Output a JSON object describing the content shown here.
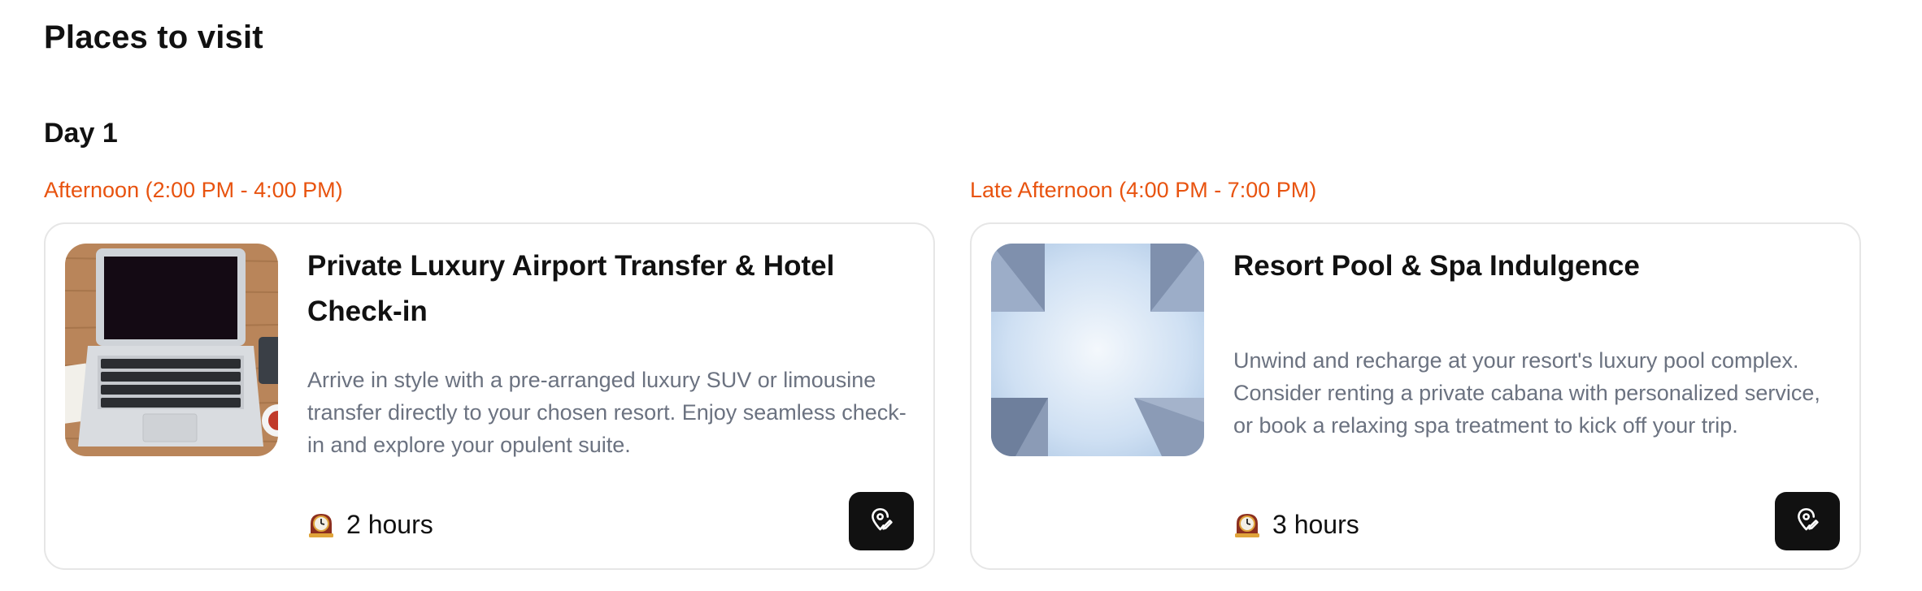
{
  "page": {
    "title": "Places to visit"
  },
  "day": {
    "heading": "Day 1"
  },
  "slots": [
    {
      "time": "Afternoon (2:00 PM - 4:00 PM)",
      "card": {
        "image_icon": "laptop-photo",
        "title": "Private Luxury Airport Transfer & Hotel Check-in",
        "description": "Arrive in style with a pre-arranged luxury SUV or limousine transfer directly to your chosen resort. Enjoy seamless check-in and explore your opulent suite.",
        "duration": "2 hours",
        "duration_icon": "mantelpiece-clock-icon",
        "action_icon": "map-pin-edit-icon"
      }
    },
    {
      "time": "Late Afternoon (4:00 PM - 7:00 PM)",
      "card": {
        "image_icon": "sky-buildings-photo",
        "title": "Resort Pool & Spa Indulgence",
        "description": "Unwind and recharge at your resort's luxury pool complex. Consider renting a private cabana with personalized service, or book a relaxing spa treatment to kick off your trip.",
        "duration": "3 hours",
        "duration_icon": "mantelpiece-clock-icon",
        "action_icon": "map-pin-edit-icon"
      }
    }
  ],
  "colors": {
    "accent": "#e8530f",
    "text": "#111111",
    "muted_text": "#6b7280",
    "card_border": "#e6e6e6",
    "button_bg": "#111111"
  }
}
